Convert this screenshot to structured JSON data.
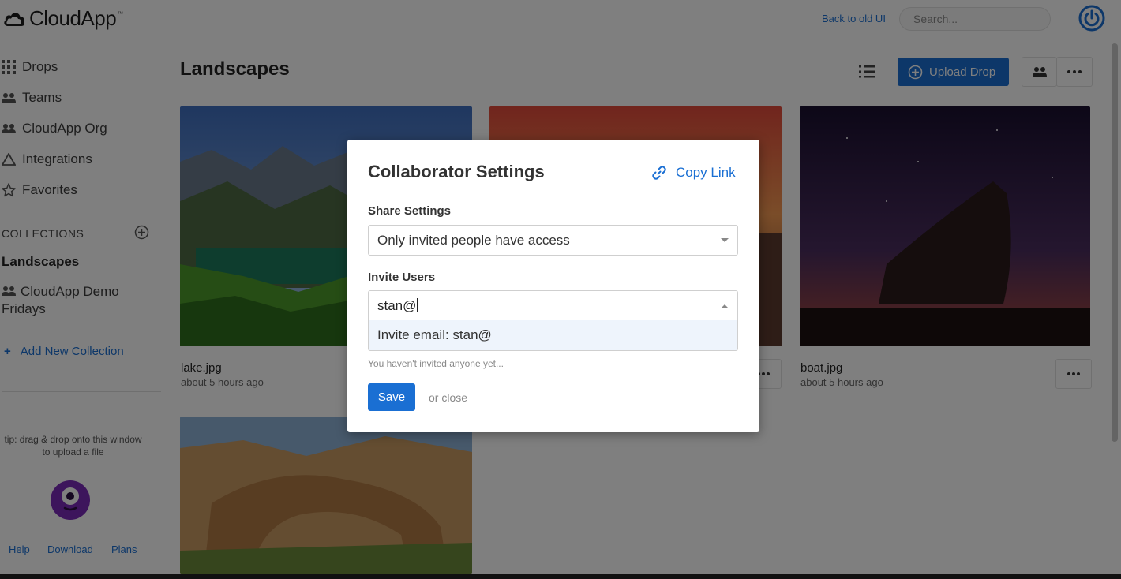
{
  "header": {
    "logo_text": "CloudApp",
    "logo_tm": "™",
    "back_link": "Back to old UI",
    "search_placeholder": "Search..."
  },
  "sidebar": {
    "nav": [
      {
        "label": "Drops",
        "icon": "grid-icon"
      },
      {
        "label": "Teams",
        "icon": "people-icon"
      },
      {
        "label": "CloudApp Org",
        "icon": "people-icon"
      },
      {
        "label": "Integrations",
        "icon": "triangle-icon"
      },
      {
        "label": "Favorites",
        "icon": "star-icon"
      }
    ],
    "collections_title": "COLLECTIONS",
    "active_collection": "Landscapes",
    "collection_item": "CloudApp Demo Fridays",
    "add_new": "Add New Collection",
    "tip": "tip: drag & drop onto this window to upload a file",
    "footer": {
      "help": "Help",
      "download": "Download",
      "plans": "Plans"
    }
  },
  "main": {
    "title": "Landscapes",
    "upload_label": "Upload Drop",
    "cards": [
      {
        "name": "lake.jpg",
        "time": "about 5 hours ago"
      },
      {
        "name": "",
        "time": ""
      },
      {
        "name": "boat.jpg",
        "time": "about 5 hours ago"
      },
      {
        "name": "",
        "time": ""
      }
    ]
  },
  "modal": {
    "title": "Collaborator Settings",
    "copy_link": "Copy Link",
    "share_label": "Share Settings",
    "share_value": "Only invited people have access",
    "invite_label": "Invite Users",
    "invite_value": "stan@",
    "option": "Invite email: stan@",
    "hint": "You haven't invited anyone yet...",
    "save": "Save",
    "close": "or close"
  },
  "colors": {
    "accent": "#1a6fd3",
    "mascot": "#7a2bb8"
  }
}
